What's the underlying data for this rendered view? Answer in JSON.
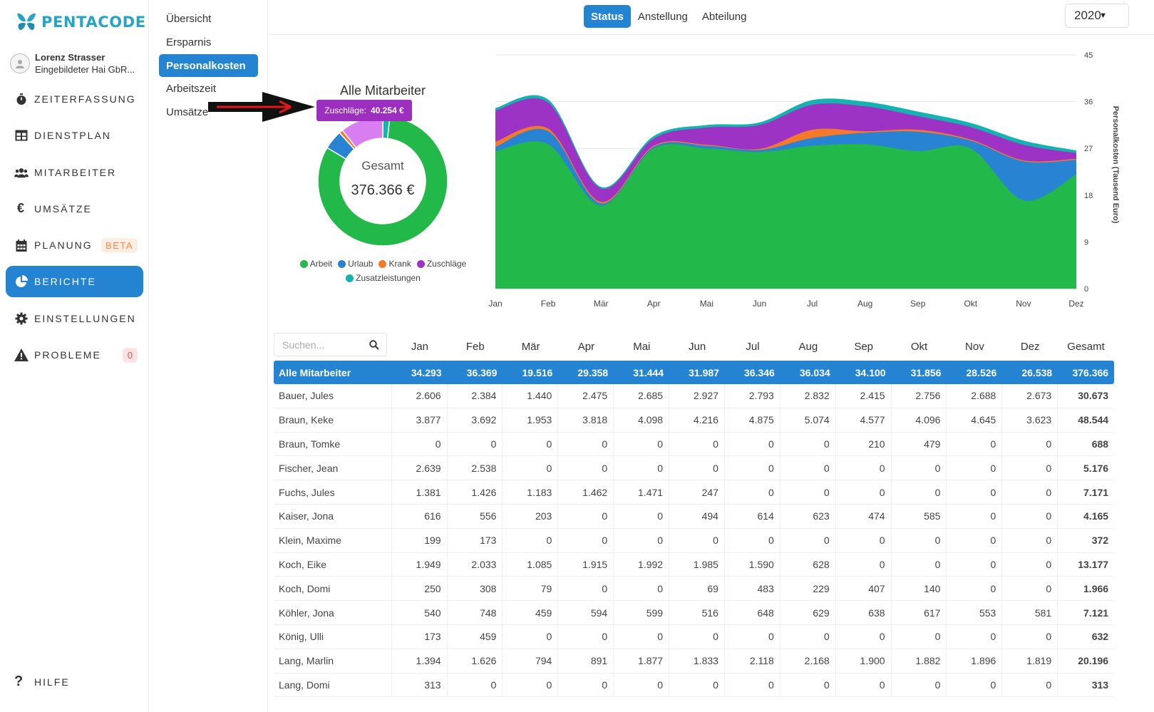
{
  "brand": {
    "name": "PENTACODE"
  },
  "user": {
    "name": "Lorenz Strasser",
    "company": "Eingebildeter Hai GbR..."
  },
  "nav": {
    "items": [
      {
        "label": "ZEITERFASSUNG",
        "icon": "stopwatch-icon"
      },
      {
        "label": "DIENSTPLAN",
        "icon": "table-icon"
      },
      {
        "label": "MITARBEITER",
        "icon": "users-icon"
      },
      {
        "label": "UMSÄTZE",
        "icon": "euro-icon"
      },
      {
        "label": "PLANUNG",
        "icon": "calendar-icon",
        "badge": "BETA"
      },
      {
        "label": "BERICHTE",
        "icon": "pie-chart-icon",
        "active": true
      },
      {
        "label": "EINSTELLUNGEN",
        "icon": "gear-icon"
      },
      {
        "label": "PROBLEME",
        "icon": "warning-icon",
        "badge": "0"
      }
    ],
    "help": "HILFE"
  },
  "subnav": {
    "items": [
      "Übersicht",
      "Ersparnis",
      "Personalkosten",
      "Arbeitszeit",
      "Umsätze"
    ],
    "active": "Personalkosten"
  },
  "tabs": {
    "items": [
      "Status",
      "Anstellung",
      "Abteilung"
    ],
    "active": "Status"
  },
  "year": {
    "value": "2020"
  },
  "donut": {
    "title": "Alle Mitarbeiter",
    "center_label": "Gesamt",
    "center_value": "376.366 €",
    "tooltip_label": "Zuschläge:",
    "tooltip_value": "40.254 €"
  },
  "colors": {
    "Arbeit": "#22b84a",
    "Urlaub": "#2884d2",
    "Krank": "#f4792a",
    "Zuschläge": "#9d33c4",
    "Zuschläge_highlight": "#d97ef0",
    "Zusatzleistungen": "#14b3b0",
    "accent": "#2484d2"
  },
  "legend": [
    "Arbeit",
    "Urlaub",
    "Krank",
    "Zuschläge",
    "Zusatzleistungen"
  ],
  "chart_data": [
    {
      "type": "pie",
      "title": "Alle Mitarbeiter",
      "categories": [
        "Arbeit",
        "Urlaub",
        "Krank",
        "Zuschläge",
        "Zusatzleistungen"
      ],
      "values": [
        307966,
        18000,
        3500,
        40254,
        6646
      ],
      "total": "376.366 €"
    },
    {
      "type": "area",
      "categories": [
        "Jan",
        "Feb",
        "Mär",
        "Apr",
        "Mai",
        "Jun",
        "Jul",
        "Aug",
        "Sep",
        "Okt",
        "Nov",
        "Dez"
      ],
      "ylabel": "Personalkosten (Tausend Euro)",
      "ylim": [
        0,
        45
      ],
      "yticks": [
        0,
        9,
        18,
        27,
        36,
        45
      ],
      "series": [
        {
          "name": "Arbeit",
          "values": [
            26.5,
            27.8,
            16.0,
            27.0,
            27.0,
            26.3,
            27.5,
            27.8,
            26.5,
            27.0,
            17.0,
            22.0
          ]
        },
        {
          "name": "Urlaub",
          "values": [
            0.8,
            2.5,
            0.4,
            0.3,
            0.5,
            0.4,
            1.5,
            2.2,
            3.7,
            1.5,
            7.5,
            2.8
          ]
        },
        {
          "name": "Krank",
          "values": [
            1.0,
            0.5,
            0.3,
            0.2,
            0.2,
            0.2,
            1.6,
            0.3,
            0.4,
            0.2,
            0.2,
            0.2
          ]
        },
        {
          "name": "Zuschläge",
          "values": [
            6.0,
            5.0,
            2.6,
            1.4,
            3.3,
            4.6,
            4.8,
            4.8,
            2.6,
            2.4,
            3.0,
            1.1
          ]
        },
        {
          "name": "Zusatzleistungen",
          "values": [
            0.5,
            0.6,
            0.3,
            0.5,
            0.5,
            0.5,
            0.9,
            0.9,
            0.9,
            0.8,
            0.8,
            0.5
          ]
        }
      ]
    }
  ],
  "table": {
    "search_placeholder": "Suchen...",
    "headers": [
      "Jan",
      "Feb",
      "Mär",
      "Apr",
      "Mai",
      "Jun",
      "Jul",
      "Aug",
      "Sep",
      "Okt",
      "Nov",
      "Dez",
      "Gesamt"
    ],
    "total_row": {
      "name": "Alle Mitarbeiter",
      "values": [
        "34.293",
        "36.369",
        "19.516",
        "29.358",
        "31.444",
        "31.987",
        "36.346",
        "36.034",
        "34.100",
        "31.856",
        "28.526",
        "26.538",
        "376.366"
      ]
    },
    "rows": [
      {
        "name": "Bauer, Jules",
        "values": [
          "2.606",
          "2.384",
          "1.440",
          "2.475",
          "2.685",
          "2.927",
          "2.793",
          "2.832",
          "2.415",
          "2.756",
          "2.688",
          "2.673",
          "30.673"
        ]
      },
      {
        "name": "Braun, Keke",
        "values": [
          "3.877",
          "3.692",
          "1.953",
          "3.818",
          "4.098",
          "4.216",
          "4.875",
          "5.074",
          "4.577",
          "4.096",
          "4.645",
          "3.623",
          "48.544"
        ]
      },
      {
        "name": "Braun, Tomke",
        "values": [
          "0",
          "0",
          "0",
          "0",
          "0",
          "0",
          "0",
          "0",
          "210",
          "479",
          "0",
          "0",
          "688"
        ]
      },
      {
        "name": "Fischer, Jean",
        "values": [
          "2.639",
          "2.538",
          "0",
          "0",
          "0",
          "0",
          "0",
          "0",
          "0",
          "0",
          "0",
          "0",
          "5.176"
        ]
      },
      {
        "name": "Fuchs, Jules",
        "values": [
          "1.381",
          "1.426",
          "1.183",
          "1.462",
          "1.471",
          "247",
          "0",
          "0",
          "0",
          "0",
          "0",
          "0",
          "7.171"
        ]
      },
      {
        "name": "Kaiser, Jona",
        "values": [
          "616",
          "556",
          "203",
          "0",
          "0",
          "494",
          "614",
          "623",
          "474",
          "585",
          "0",
          "0",
          "4.165"
        ]
      },
      {
        "name": "Klein, Maxime",
        "values": [
          "199",
          "173",
          "0",
          "0",
          "0",
          "0",
          "0",
          "0",
          "0",
          "0",
          "0",
          "0",
          "372"
        ]
      },
      {
        "name": "Koch, Eike",
        "values": [
          "1.949",
          "2.033",
          "1.085",
          "1.915",
          "1.992",
          "1.985",
          "1.590",
          "628",
          "0",
          "0",
          "0",
          "0",
          "13.177"
        ]
      },
      {
        "name": "Koch, Domi",
        "values": [
          "250",
          "308",
          "79",
          "0",
          "0",
          "69",
          "483",
          "229",
          "407",
          "140",
          "0",
          "0",
          "1.966"
        ]
      },
      {
        "name": "Köhler, Jona",
        "values": [
          "540",
          "748",
          "459",
          "594",
          "599",
          "516",
          "648",
          "629",
          "638",
          "617",
          "553",
          "581",
          "7.121"
        ]
      },
      {
        "name": "König, Ulli",
        "values": [
          "173",
          "459",
          "0",
          "0",
          "0",
          "0",
          "0",
          "0",
          "0",
          "0",
          "0",
          "0",
          "632"
        ]
      },
      {
        "name": "Lang, Marlin",
        "values": [
          "1.394",
          "1.626",
          "794",
          "891",
          "1.877",
          "1.833",
          "2.118",
          "2.168",
          "1.900",
          "1.882",
          "1.896",
          "1.819",
          "20.196"
        ]
      },
      {
        "name": "Lang, Domi",
        "values": [
          "313",
          "0",
          "0",
          "0",
          "0",
          "0",
          "0",
          "0",
          "0",
          "0",
          "0",
          "0",
          "313"
        ]
      }
    ]
  }
}
